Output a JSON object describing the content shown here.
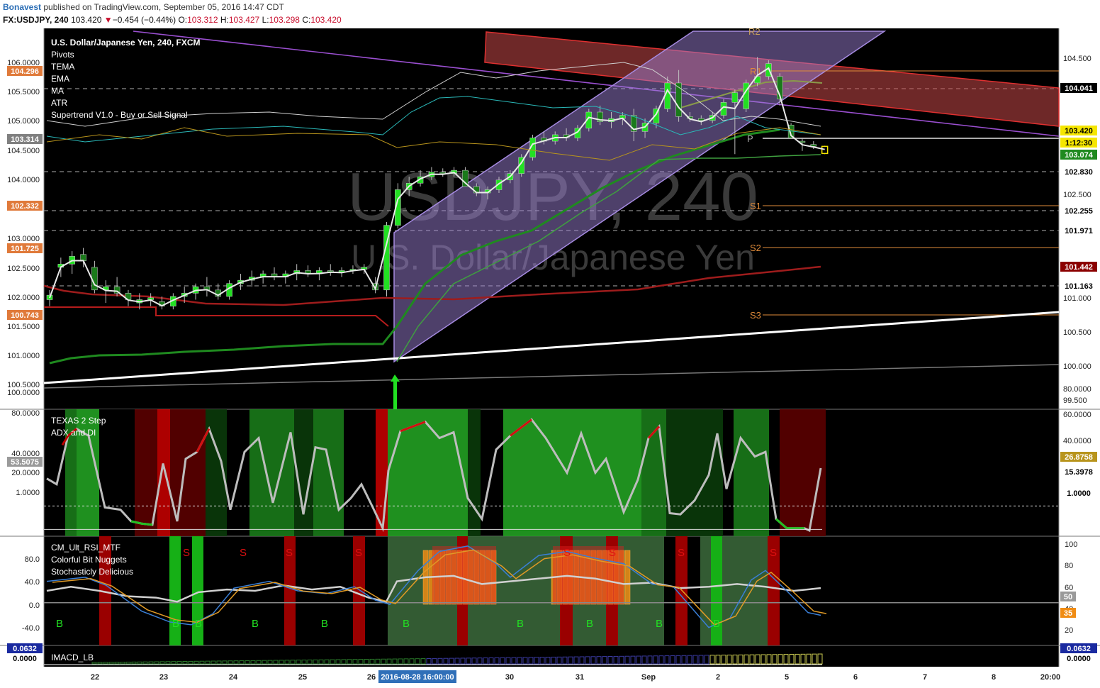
{
  "header": {
    "publisher": "Bonavest",
    "published_text": "published on TradingView.com, September 05, 2016 14:47 CDT",
    "symbol": "FX:USDJPY, 240",
    "last": "103.420",
    "change_arrow": "▼",
    "change": "−0.454 (−0.44%)",
    "o_label": "O:",
    "o_value": "103.312",
    "h_label": "H:",
    "h_value": "103.427",
    "l_label": "L:",
    "l_value": "103.298",
    "c_label": "C:",
    "c_value": "103.420"
  },
  "watermark": {
    "line1": "USDJPY, 240",
    "line2": "U.S. Dollar/Japanese Yen"
  },
  "legends": {
    "main": [
      "U.S. Dollar/Japanese Yen, 240, FXCM",
      "Pivots",
      "TEMA",
      "EMA",
      "MA",
      "ATR",
      "Supertrend V1.0 - Buy or Sell Signal"
    ],
    "pane2": [
      "TEXAS 2 Step",
      "ADX and DI"
    ],
    "pane3": [
      "CM_Ult_RSI_MTF",
      "Colorful Bit Nuggets",
      "Stochasticly Delicious"
    ],
    "pane4": [
      "IMACD_LB"
    ]
  },
  "pivot_labels": [
    "R2",
    "R1",
    "P",
    "S1",
    "S2",
    "S3"
  ],
  "signal_labels": {
    "buy": "B",
    "sell": "S"
  },
  "colors": {
    "background": "#000000",
    "axis_bg": "#ffffff",
    "candle_up": "#22e022",
    "candle_down": "#1a7a1a",
    "candle_last": "#f5e600",
    "channel": "#9b7fd4",
    "resistance_box": "#c84848",
    "trendline": "#ffffff",
    "tema": "#e8e8e8",
    "supertrend": "#9e1c1c",
    "rsi_white": "#d0d0d0",
    "rsi_blue": "#3a7fd6",
    "rsi_orange": "#e09a26"
  },
  "chart_data": [
    {
      "type": "candlestick",
      "title": "U.S. Dollar/Japanese Yen, 240, FXCM",
      "x_ticks": [
        "22",
        "23",
        "24",
        "25",
        "26",
        "2016-08-28 16:00:00",
        "30",
        "31",
        "Sep",
        "2",
        "5",
        "6",
        "7",
        "8",
        "20:00"
      ],
      "left_axis": {
        "ticks": [
          "100.5000",
          "101.0000",
          "101.5000",
          "102.0000",
          "102.5000",
          "103.0000",
          "104.0000",
          "104.5000",
          "105.0000",
          "105.5000",
          "106.0000"
        ],
        "badges": [
          "104.296",
          "103.314",
          "102.332",
          "101.725",
          "100.743"
        ]
      },
      "right_axis": {
        "ticks": [
          "99.500",
          "100.000",
          "100.500",
          "101.000",
          "102.500",
          "104.500"
        ],
        "badges": [
          "104.041",
          "103.420",
          "1:12:30",
          "103.074",
          "102.830",
          "102.255",
          "101.971",
          "101.442",
          "101.163"
        ]
      },
      "ylim": [
        99.4,
        105.2
      ],
      "candles": [
        [
          101.05,
          101.2,
          100.95,
          101.12
        ],
        [
          101.55,
          101.7,
          101.4,
          101.6
        ],
        [
          101.6,
          101.8,
          101.45,
          101.72
        ],
        [
          101.75,
          101.85,
          101.55,
          101.65
        ],
        [
          101.55,
          101.65,
          101.15,
          101.2
        ],
        [
          101.2,
          101.35,
          101.0,
          101.25
        ],
        [
          101.25,
          101.4,
          101.1,
          101.15
        ],
        [
          101.15,
          101.2,
          100.95,
          101.05
        ],
        [
          101.0,
          101.15,
          100.9,
          101.05
        ],
        [
          101.05,
          101.15,
          100.95,
          101.08
        ],
        [
          101.02,
          101.1,
          100.9,
          100.95
        ],
        [
          100.95,
          101.15,
          100.9,
          101.1
        ],
        [
          101.1,
          101.25,
          101.0,
          101.15
        ],
        [
          101.15,
          101.3,
          101.05,
          101.25
        ],
        [
          101.25,
          101.4,
          101.1,
          101.2
        ],
        [
          101.2,
          101.3,
          101.05,
          101.1
        ],
        [
          101.1,
          101.35,
          101.05,
          101.3
        ],
        [
          101.3,
          101.45,
          101.2,
          101.35
        ],
        [
          101.35,
          101.5,
          101.25,
          101.4
        ],
        [
          101.4,
          101.5,
          101.3,
          101.45
        ],
        [
          101.45,
          101.55,
          101.35,
          101.4
        ],
        [
          101.4,
          101.5,
          101.3,
          101.45
        ],
        [
          101.45,
          101.6,
          101.35,
          101.5
        ],
        [
          101.5,
          101.58,
          101.4,
          101.45
        ],
        [
          101.45,
          101.55,
          101.35,
          101.5
        ],
        [
          101.5,
          101.6,
          101.42,
          101.48
        ],
        [
          101.48,
          101.55,
          101.4,
          101.5
        ],
        [
          101.5,
          101.58,
          101.45,
          101.52
        ],
        [
          101.52,
          101.6,
          101.45,
          101.55
        ],
        [
          101.3,
          101.4,
          101.15,
          101.2
        ],
        [
          101.2,
          102.25,
          101.1,
          102.2
        ],
        [
          102.2,
          102.85,
          102.15,
          102.75
        ],
        [
          102.75,
          102.95,
          102.65,
          102.85
        ],
        [
          102.85,
          103.05,
          102.8,
          102.95
        ],
        [
          102.95,
          103.1,
          102.9,
          103.02
        ],
        [
          103.02,
          103.08,
          102.95,
          103.0
        ],
        [
          103.0,
          103.1,
          102.95,
          103.05
        ],
        [
          103.05,
          103.1,
          102.8,
          102.8
        ],
        [
          102.8,
          102.85,
          102.65,
          102.7
        ],
        [
          102.7,
          102.8,
          102.6,
          102.75
        ],
        [
          102.75,
          102.95,
          102.7,
          102.9
        ],
        [
          102.9,
          103.05,
          102.85,
          103.0
        ],
        [
          103.0,
          103.3,
          102.95,
          103.25
        ],
        [
          103.25,
          103.6,
          103.2,
          103.55
        ],
        [
          103.55,
          103.65,
          103.45,
          103.5
        ],
        [
          103.5,
          103.65,
          103.45,
          103.6
        ],
        [
          103.6,
          103.7,
          103.5,
          103.55
        ],
        [
          103.55,
          103.75,
          103.5,
          103.7
        ],
        [
          103.7,
          104.0,
          103.65,
          103.95
        ],
        [
          103.95,
          104.05,
          103.75,
          103.8
        ],
        [
          103.8,
          103.95,
          103.7,
          103.85
        ],
        [
          103.85,
          103.95,
          103.75,
          103.9
        ],
        [
          103.9,
          104.0,
          103.5,
          103.65
        ],
        [
          103.65,
          103.85,
          103.55,
          103.78
        ],
        [
          103.78,
          104.05,
          103.7,
          104.0
        ],
        [
          104.0,
          104.5,
          103.95,
          104.4
        ],
        [
          104.4,
          104.6,
          103.8,
          103.88
        ],
        [
          103.88,
          103.95,
          103.8,
          103.85
        ],
        [
          103.85,
          103.9,
          103.75,
          103.82
        ],
        [
          103.82,
          103.95,
          103.78,
          103.9
        ],
        [
          103.9,
          104.15,
          103.85,
          104.1
        ],
        [
          104.1,
          104.3,
          103.3,
          104.25
        ],
        [
          104.0,
          104.45,
          103.95,
          104.4
        ],
        [
          104.4,
          104.8,
          104.35,
          104.5
        ],
        [
          104.5,
          104.75,
          104.45,
          104.7
        ],
        [
          104.5,
          104.55,
          104.05,
          104.15
        ],
        [
          103.75,
          103.78,
          103.55,
          103.55
        ],
        [
          103.5,
          103.55,
          103.35,
          103.48
        ],
        [
          103.45,
          103.5,
          103.38,
          103.42
        ],
        [
          103.31,
          103.43,
          103.3,
          103.42
        ]
      ]
    },
    {
      "type": "line",
      "title": "TEXAS 2 Step / ADX and DI",
      "left_axis": {
        "ticks": [
          "1.0000",
          "20.0000",
          "40.0000",
          "80.0000",
          "100.0000"
        ],
        "badge": "53.5075"
      },
      "right_axis": {
        "ticks": [
          "40.0000",
          "60.0000",
          "80.0000"
        ],
        "badges": [
          "26.8758",
          "15.3978",
          "1.0000"
        ]
      }
    },
    {
      "type": "line",
      "title": "CM_Ult_RSI_MTF",
      "left_axis": {
        "ticks": [
          "-40.0",
          "0.0",
          "40.0",
          "80.0"
        ]
      },
      "right_axis": {
        "ticks": [
          "20",
          "40",
          "60",
          "80",
          "100"
        ],
        "badges": [
          "50",
          "35"
        ]
      }
    },
    {
      "type": "bar",
      "title": "IMACD_LB",
      "left_axis": {
        "badges": [
          "0.0632",
          "0.0000"
        ]
      },
      "right_axis": {
        "badges": [
          "0.0632",
          "0.0000"
        ]
      }
    }
  ]
}
